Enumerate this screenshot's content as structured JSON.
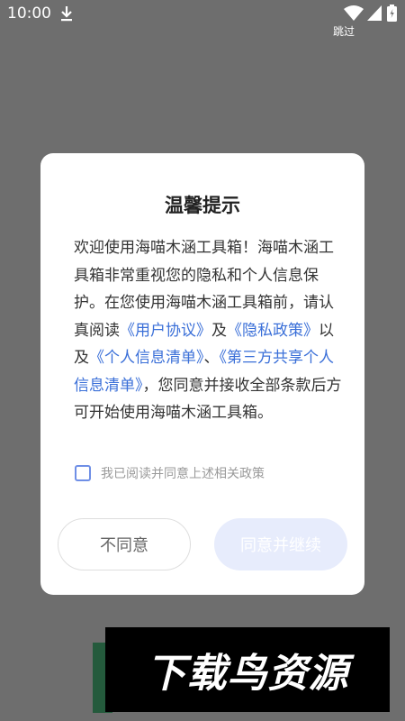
{
  "status_bar": {
    "time": "10:00",
    "icons": [
      "download-icon",
      "wifi-icon",
      "signal-icon",
      "battery-icon"
    ]
  },
  "skip_label": "跳过",
  "dialog": {
    "title": "温馨提示",
    "body": {
      "intro": "欢迎使用海喵木涵工具箱！海喵木涵工具箱非常重视您的隐私和个人信息保护。在您使用海喵木涵工具箱前，请认真阅读",
      "link_user_agreement": "《用户协议》",
      "and_1": "及",
      "link_privacy_policy": "《隐私政策》",
      "and_2": "以及",
      "link_personal_info_list": "《个人信息清单》",
      "sep": "、",
      "link_third_party_list": "《第三方共享个人信息清单》",
      "outro": "，您同意并接收全部条款后方可开始使用海喵木涵工具箱。"
    },
    "consent_label": "我已阅读并同意上述相关政策",
    "consent_checked": false,
    "disagree_label": "不同意",
    "agree_label": "同意并继续"
  },
  "watermark": {
    "text": "下载鸟资源"
  },
  "colors": {
    "overlay": "#6e6e6e",
    "link": "#3a6fd8",
    "agree_button_disabled": "#e7ecfc",
    "checkbox_border": "#6f8fe6"
  }
}
